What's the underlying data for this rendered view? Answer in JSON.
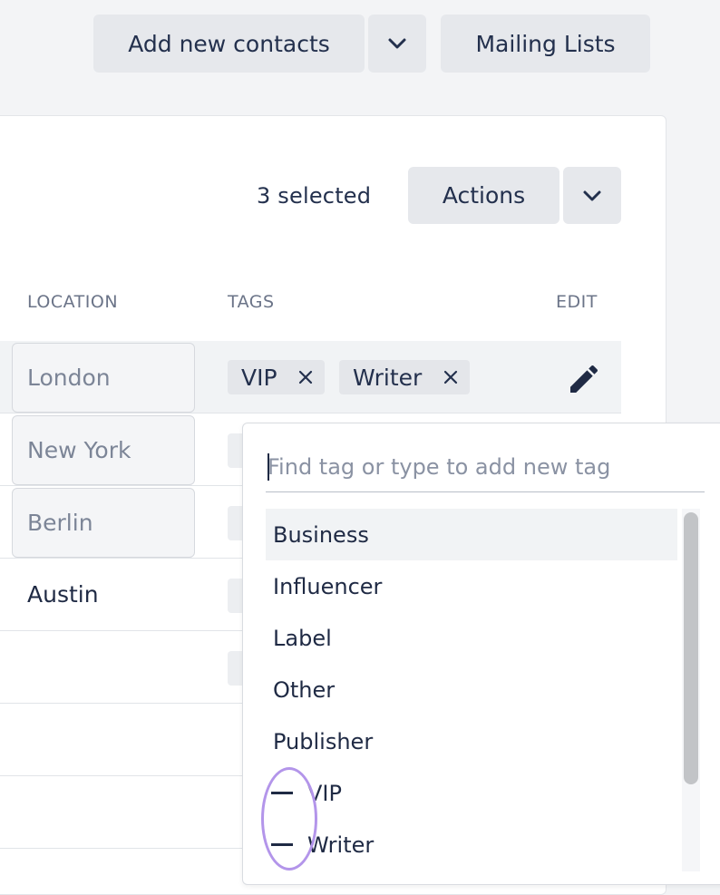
{
  "header": {
    "add_contacts_label": "Add new contacts",
    "mailing_lists_label": "Mailing Lists"
  },
  "toolbar": {
    "selected_count": "3 selected",
    "actions_label": "Actions"
  },
  "table": {
    "columns": [
      "LOCATION",
      "TAGS",
      "EDIT"
    ],
    "rows": [
      {
        "location": "London",
        "editing": true,
        "tags": [
          "VIP",
          "Writer"
        ]
      },
      {
        "location": "New York",
        "editing": true
      },
      {
        "location": "Berlin",
        "editing": true
      },
      {
        "location": "Austin",
        "editing": false
      },
      {
        "location": "",
        "editing": false
      },
      {
        "location": "",
        "editing": false
      },
      {
        "location": "",
        "editing": false
      }
    ]
  },
  "tag_dropdown": {
    "search_placeholder": "Find tag or type to add new tag",
    "options": [
      {
        "label": "Business",
        "highlighted": true,
        "selected": false
      },
      {
        "label": "Influencer",
        "highlighted": false,
        "selected": false
      },
      {
        "label": "Label",
        "highlighted": false,
        "selected": false
      },
      {
        "label": "Other",
        "highlighted": false,
        "selected": false
      },
      {
        "label": "Publisher",
        "highlighted": false,
        "selected": false
      },
      {
        "label": "VIP",
        "highlighted": false,
        "selected": true
      },
      {
        "label": "Writer",
        "highlighted": false,
        "selected": true
      }
    ]
  },
  "icons": {
    "dropdown_toggle": "chevron-down-icon",
    "remove_tag": "close-icon",
    "edit": "pencil-icon",
    "selected_option": "minus-icon"
  },
  "colors": {
    "background": "#f3f4f6",
    "button_bg": "#e6e8ec",
    "text_primary": "#1f2a44",
    "annotation": "#b395ea"
  }
}
